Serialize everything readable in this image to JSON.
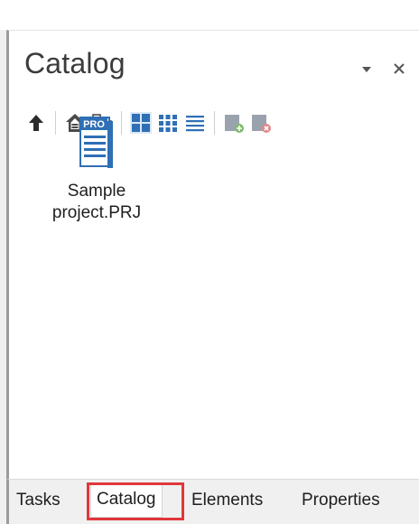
{
  "panel": {
    "title": "Catalog",
    "controls": {
      "dropdown_icon": "chevron-down-icon",
      "close_icon": "close-icon"
    }
  },
  "toolbar": {
    "buttons": [
      {
        "icon": "arrow-up-icon"
      },
      {
        "icon": "home-folder-icon"
      },
      {
        "icon": "tree-view-icon"
      },
      {
        "icon": "large-icons-view-icon"
      },
      {
        "icon": "small-icons-view-icon"
      },
      {
        "icon": "list-view-icon"
      },
      {
        "icon": "add-item-icon"
      },
      {
        "icon": "remove-item-icon"
      }
    ]
  },
  "items": [
    {
      "badge": "PRO",
      "label": "Sample\nproject.PRJ",
      "icon": "project-file-icon"
    }
  ],
  "tabs": [
    {
      "label": "Tasks"
    },
    {
      "label": "Catalog",
      "active": true
    },
    {
      "label": "Elements"
    },
    {
      "label": "Properties"
    }
  ],
  "colors": {
    "accent_blue": "#2f6fb5",
    "highlight_red": "#e0373b",
    "text": "#1e1e1e",
    "tab_bar_bg": "#f0f0f0"
  }
}
